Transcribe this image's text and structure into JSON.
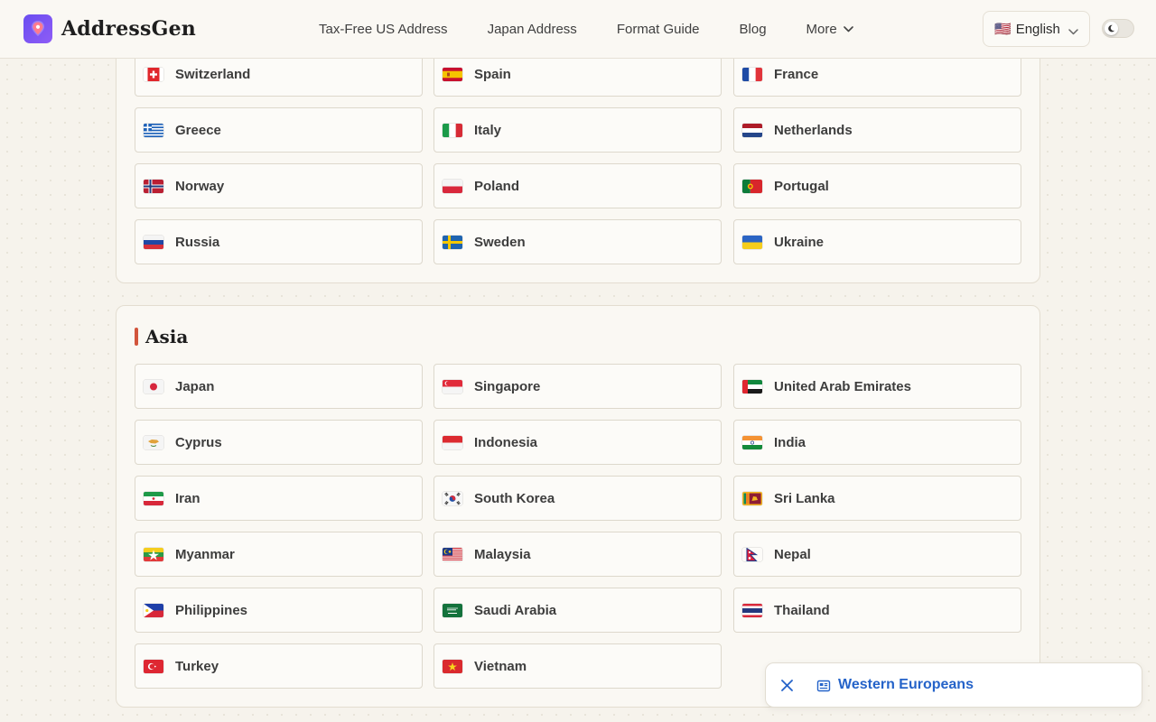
{
  "app": {
    "name": "AddressGen"
  },
  "nav": {
    "items": [
      "Tax-Free US Address",
      "Japan Address",
      "Format Guide",
      "Blog"
    ],
    "more_label": "More"
  },
  "language": {
    "selected": "English",
    "flag": "🇺🇸"
  },
  "theme_toggle": {
    "state": "light",
    "icon": "moon-icon"
  },
  "regions": {
    "europe": {
      "countries": [
        {
          "name": "Switzerland",
          "flag": "switzerland"
        },
        {
          "name": "Spain",
          "flag": "spain"
        },
        {
          "name": "France",
          "flag": "france"
        },
        {
          "name": "Greece",
          "flag": "greece"
        },
        {
          "name": "Italy",
          "flag": "italy"
        },
        {
          "name": "Netherlands",
          "flag": "netherlands"
        },
        {
          "name": "Norway",
          "flag": "norway"
        },
        {
          "name": "Poland",
          "flag": "poland"
        },
        {
          "name": "Portugal",
          "flag": "portugal"
        },
        {
          "name": "Russia",
          "flag": "russia"
        },
        {
          "name": "Sweden",
          "flag": "sweden"
        },
        {
          "name": "Ukraine",
          "flag": "ukraine"
        }
      ]
    },
    "asia": {
      "title": "Asia",
      "countries": [
        {
          "name": "Japan",
          "flag": "japan"
        },
        {
          "name": "Singapore",
          "flag": "singapore"
        },
        {
          "name": "United Arab Emirates",
          "flag": "uae"
        },
        {
          "name": "Cyprus",
          "flag": "cyprus"
        },
        {
          "name": "Indonesia",
          "flag": "indonesia"
        },
        {
          "name": "India",
          "flag": "india"
        },
        {
          "name": "Iran",
          "flag": "iran"
        },
        {
          "name": "South Korea",
          "flag": "south-korea"
        },
        {
          "name": "Sri Lanka",
          "flag": "sri-lanka"
        },
        {
          "name": "Myanmar",
          "flag": "myanmar"
        },
        {
          "name": "Malaysia",
          "flag": "malaysia"
        },
        {
          "name": "Nepal",
          "flag": "nepal"
        },
        {
          "name": "Philippines",
          "flag": "philippines"
        },
        {
          "name": "Saudi Arabia",
          "flag": "saudi-arabia"
        },
        {
          "name": "Thailand",
          "flag": "thailand"
        },
        {
          "name": "Turkey",
          "flag": "turkey"
        },
        {
          "name": "Vietnam",
          "flag": "vietnam"
        }
      ]
    }
  },
  "toast": {
    "link_text": "Western Europeans"
  },
  "colors": {
    "accent": "#d2553c",
    "brand": "#6a4ef0",
    "link": "#2563c9"
  }
}
